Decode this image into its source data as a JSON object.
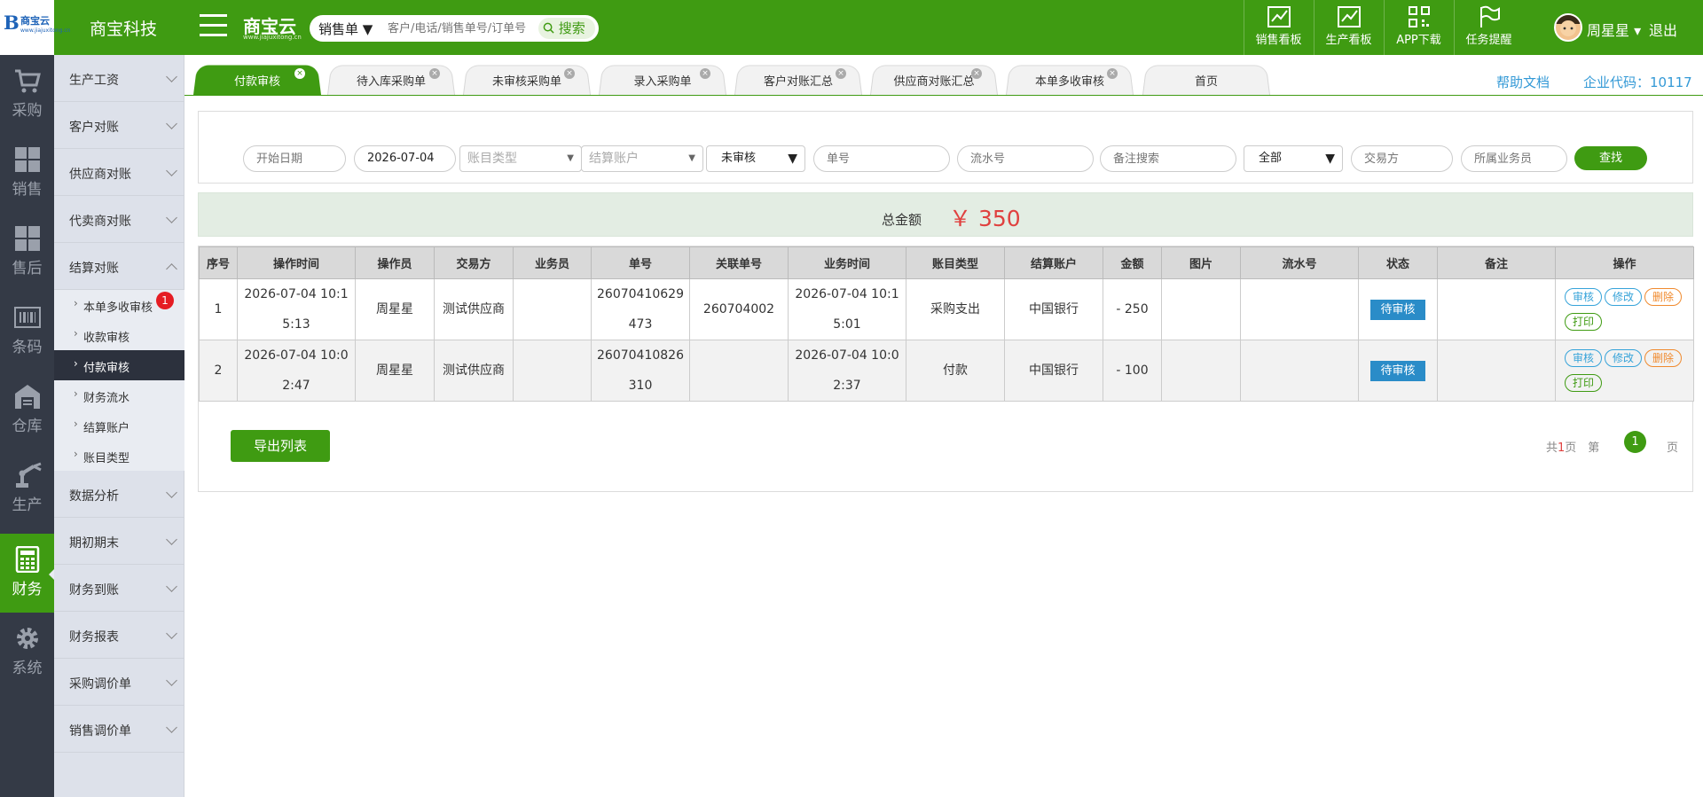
{
  "header": {
    "logo_text": "商宝云",
    "logo_sub": "www.jiajuxitong.cn",
    "company": "商宝科技",
    "brand": "商宝云",
    "brand_sub": "www.jiajuxitong.cn",
    "search_type": "销售单 ▼",
    "search_placeholder": "客户/电话/销售单号/订单号",
    "search_button": "搜索",
    "tools": [
      {
        "label": "销售看板",
        "icon": "chart-trend-icon"
      },
      {
        "label": "生产看板",
        "icon": "chart-trend-icon"
      },
      {
        "label": "APP下载",
        "icon": "qrcode-icon"
      },
      {
        "label": "任务提醒",
        "icon": "flag-icon"
      }
    ],
    "user_name": "周星星 ▾",
    "logout": "退出"
  },
  "iconbar": [
    {
      "label": "采购",
      "icon": "cart-icon"
    },
    {
      "label": "销售",
      "icon": "grid-icon"
    },
    {
      "label": "售后",
      "icon": "grid-icon"
    },
    {
      "label": "条码",
      "icon": "barcode-icon"
    },
    {
      "label": "仓库",
      "icon": "warehouse-icon"
    },
    {
      "label": "生产",
      "icon": "robot-arm-icon"
    },
    {
      "label": "财务",
      "icon": "calculator-icon",
      "active": true
    },
    {
      "label": "系统",
      "icon": "gear-icon"
    }
  ],
  "submenu": {
    "groups_top": [
      "生产工资",
      "客户对账",
      "供应商对账",
      "代卖商对账",
      "结算对账"
    ],
    "children": [
      {
        "label": "本单多收审核",
        "badge": "1"
      },
      {
        "label": "收款审核"
      },
      {
        "label": "付款审核",
        "active": true
      },
      {
        "label": "财务流水"
      },
      {
        "label": "结算账户"
      },
      {
        "label": "账目类型"
      }
    ],
    "groups_bottom": [
      "数据分析",
      "期初期末",
      "财务到账",
      "财务报表",
      "采购调价单",
      "销售调价单"
    ]
  },
  "tabs": [
    {
      "label": "付款审核",
      "active": true
    },
    {
      "label": "待入库采购单"
    },
    {
      "label": "未审核采购单"
    },
    {
      "label": "录入采购单"
    },
    {
      "label": "客户对账汇总"
    },
    {
      "label": "供应商对账汇总"
    },
    {
      "label": "本单多收审核"
    },
    {
      "label": "首页"
    }
  ],
  "help": "帮助文档",
  "corp_code": "企业代码：10117",
  "filters": {
    "start_date": "开始日期",
    "date_value": "2026-07-04",
    "account_type": "账目类型",
    "settle_account": "结算账户",
    "status": "未审核",
    "order_no": "单号",
    "serial_no": "流水号",
    "remark": "备注搜索",
    "all": "全部",
    "party": "交易方",
    "salesman": "所属业务员",
    "find": "查找"
  },
  "total": {
    "label": "总金额",
    "value": "￥ 350"
  },
  "table": {
    "headers": [
      "序号",
      "操作时间",
      "操作员",
      "交易方",
      "业务员",
      "单号",
      "关联单号",
      "业务时间",
      "账目类型",
      "结算账户",
      "金额",
      "图片",
      "流水号",
      "状态",
      "备注",
      "操作"
    ],
    "rows": [
      [
        "1",
        "2026-07-04 10:15:13",
        "周星星",
        "测试供应商",
        "",
        "26070410629473",
        "260704002",
        "2026-07-04 10:15:01",
        "采购支出",
        "中国银行",
        "- 250",
        "",
        "",
        "待审核",
        "",
        ""
      ],
      [
        "2",
        "2026-07-04 10:02:47",
        "周星星",
        "测试供应商",
        "",
        "26070410826310",
        "",
        "2026-07-04 10:02:37",
        "付款",
        "中国银行",
        "- 100",
        "",
        "",
        "待审核",
        "",
        ""
      ]
    ],
    "ops": {
      "audit": "审核",
      "edit": "修改",
      "del": "删除",
      "print": "打印"
    }
  },
  "footer": {
    "export": "导出列表",
    "pager_prefix": "共",
    "pager_count": "1",
    "pager_suffix": "页　第",
    "current_page": "1",
    "page_end": "页"
  }
}
